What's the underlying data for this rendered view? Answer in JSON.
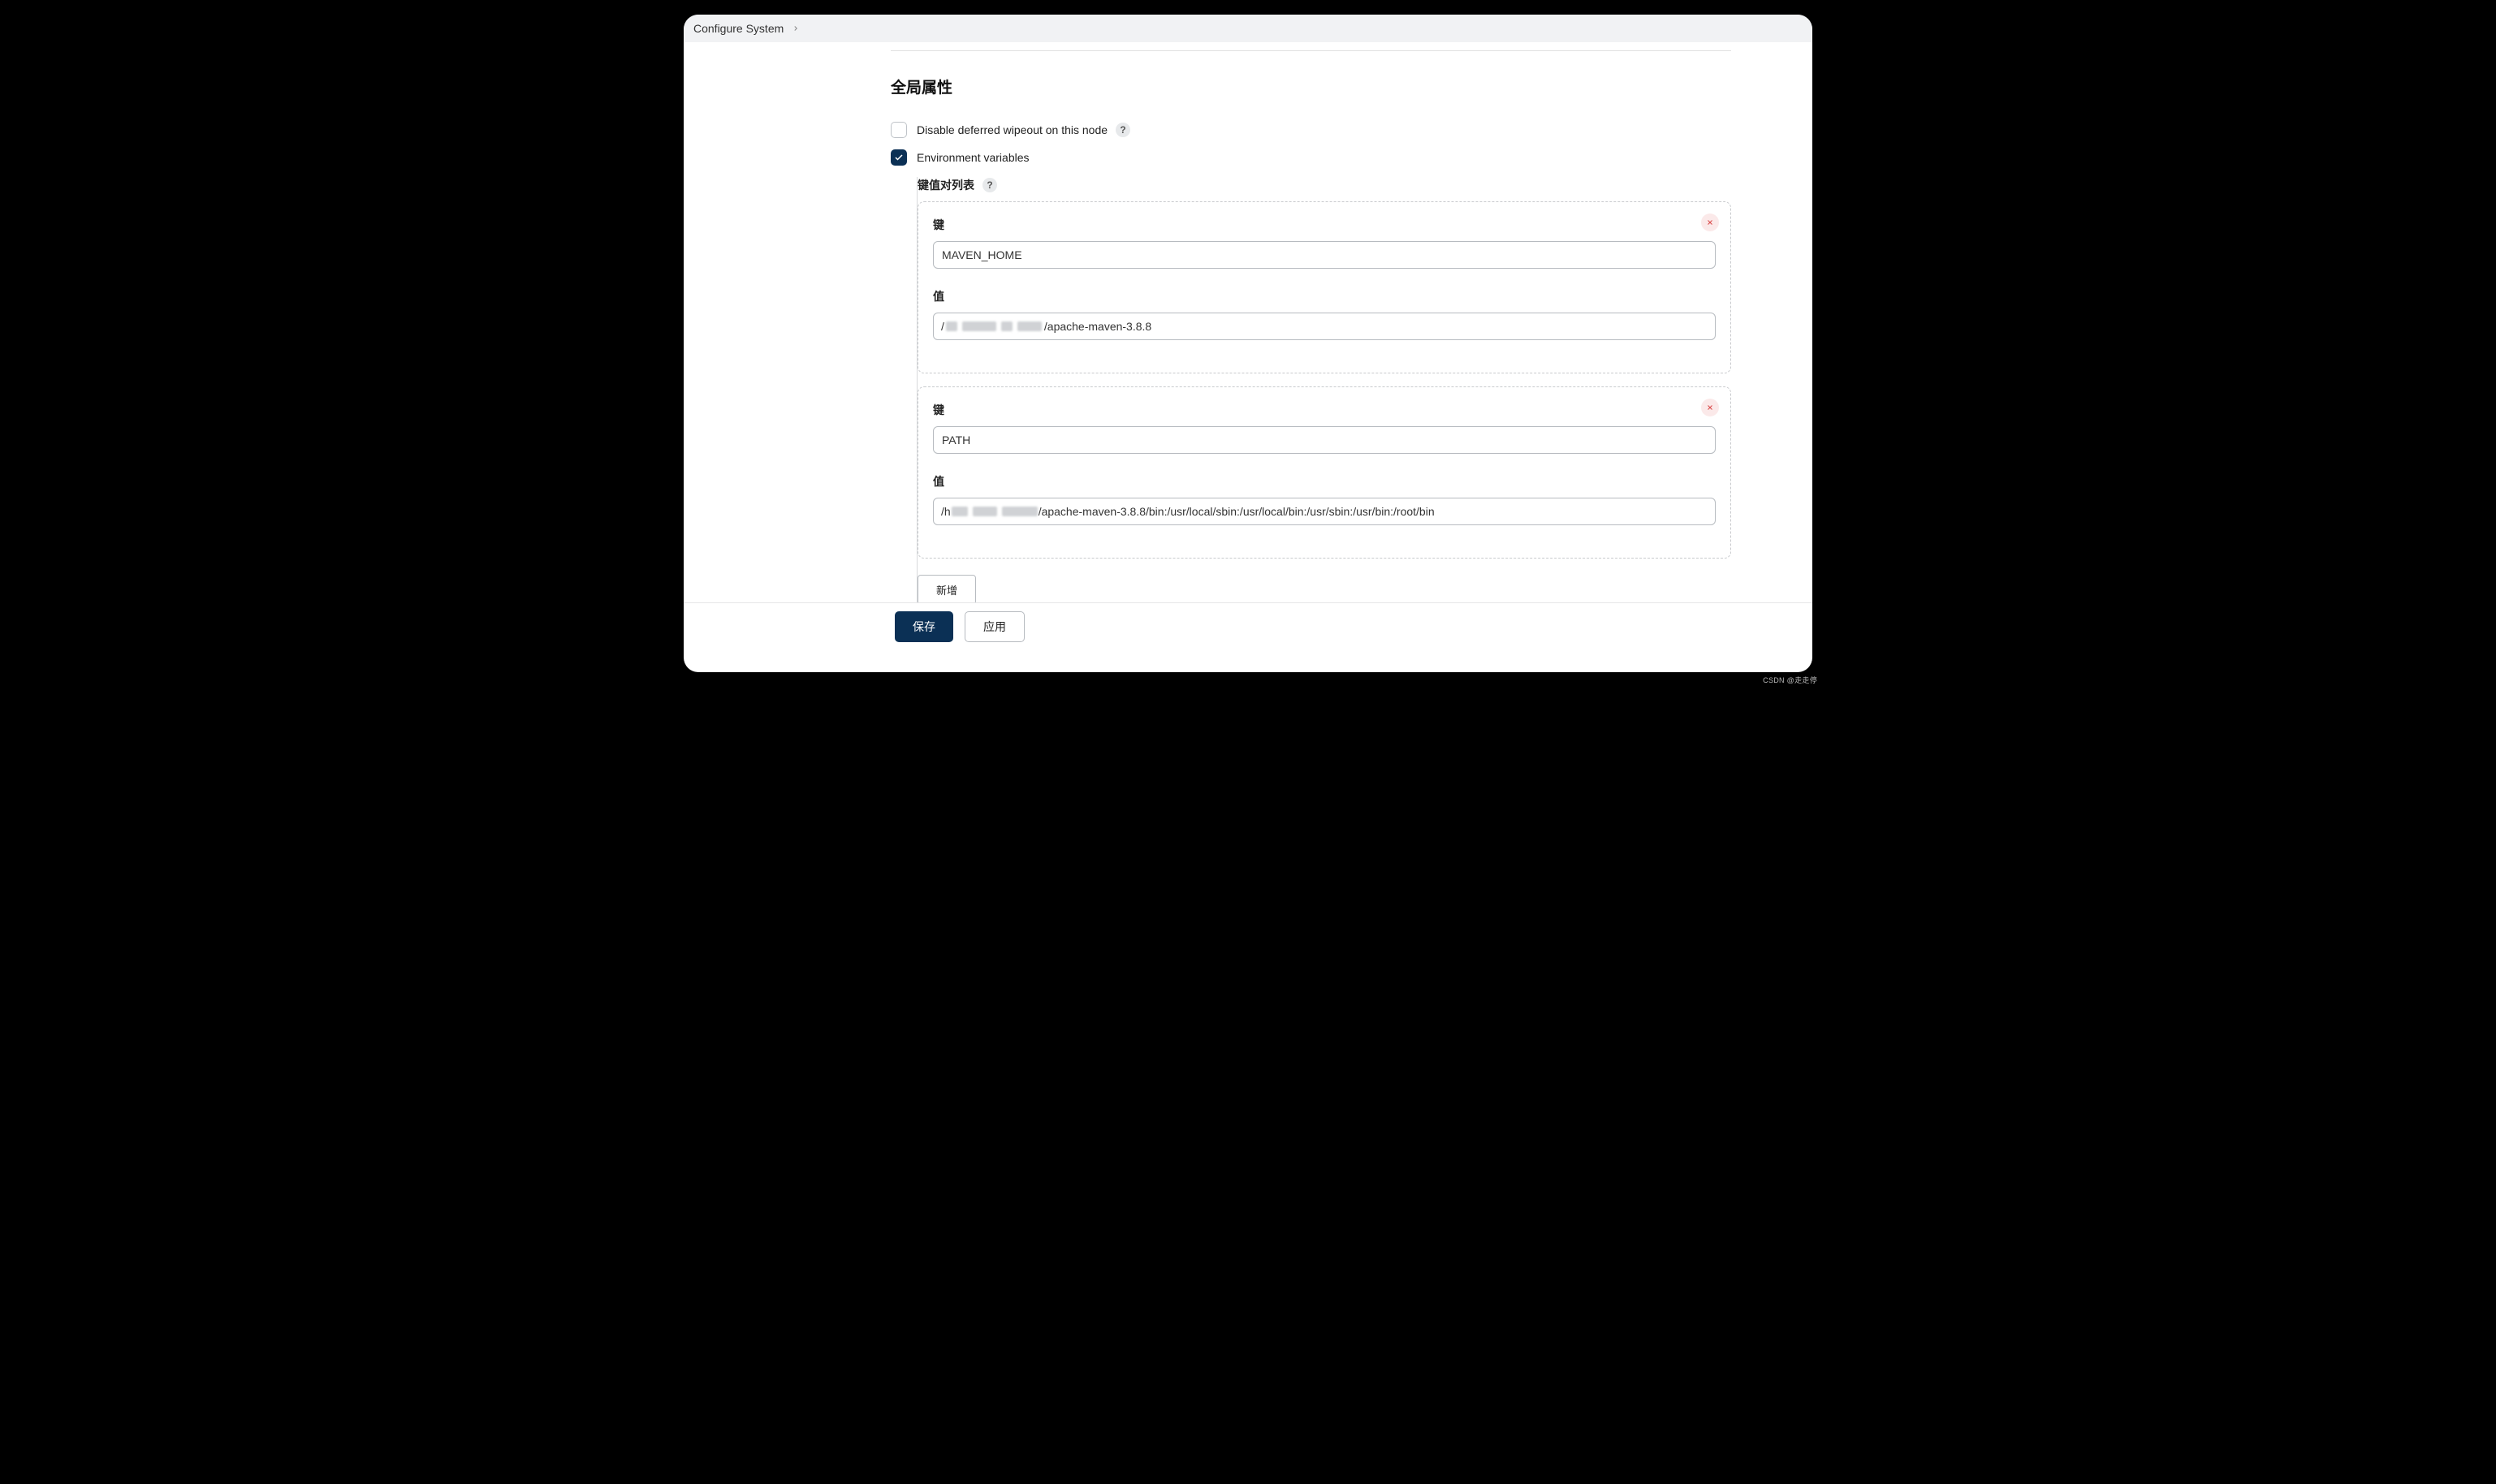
{
  "breadcrumb": {
    "title": "Configure System"
  },
  "section": {
    "title": "全局属性"
  },
  "options": {
    "disable_wipeout": {
      "label": "Disable deferred wipeout on this node",
      "checked": false
    },
    "env_vars": {
      "label": "Environment variables",
      "checked": true
    }
  },
  "env": {
    "list_label": "键值对列表",
    "key_label": "键",
    "value_label": "值",
    "add_label": "新增",
    "entries": [
      {
        "key": "MAVEN_HOME",
        "value_prefix": "/",
        "value_suffix": "/apache-maven-3.8.8",
        "value": "/                       /apache-maven-3.8.8"
      },
      {
        "key": "PATH",
        "value_prefix": "/h",
        "value_suffix": "/apache-maven-3.8.8/bin:/usr/local/sbin:/usr/local/bin:/usr/sbin:/usr/bin:/root/bin",
        "value": "/h                      /apache-maven-3.8.8/bin:/usr/local/sbin:/usr/local/bin:/usr/sbin:/usr/bin:/root/bin"
      }
    ]
  },
  "footer": {
    "save_label": "保存",
    "apply_label": "应用"
  },
  "watermark": "CSDN @走走停"
}
